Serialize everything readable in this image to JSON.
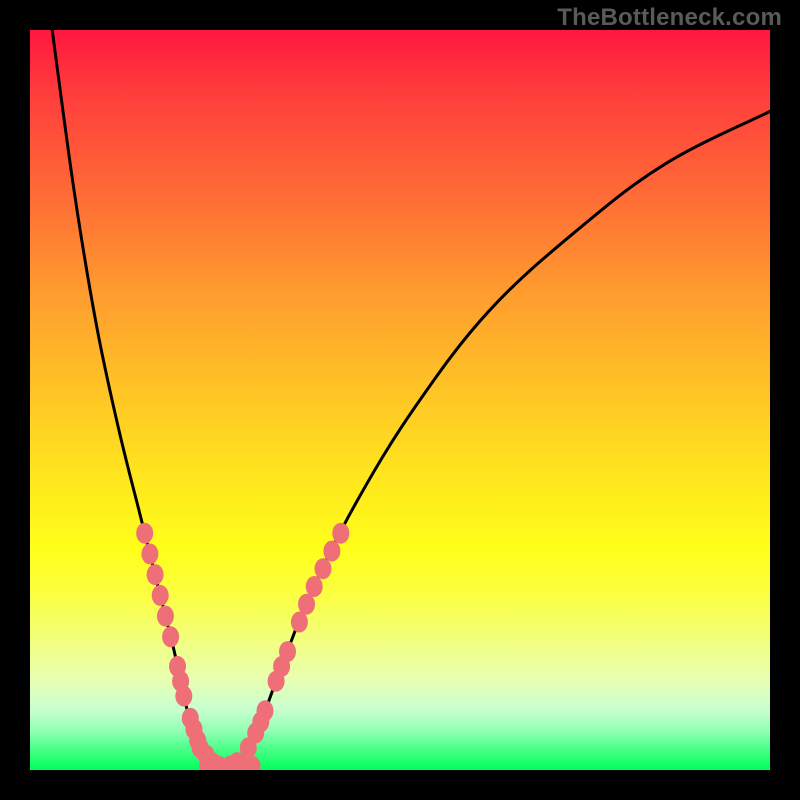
{
  "watermark": "TheBottleneck.com",
  "colors": {
    "background": "#000000",
    "gradient_top": "#ff163f",
    "gradient_bottom": "#00ff5c",
    "curve": "#000000",
    "bead": "#ef6f78"
  },
  "chart_data": {
    "type": "line",
    "title": "",
    "xlabel": "",
    "ylabel": "",
    "xlim": [
      0,
      100
    ],
    "ylim": [
      0,
      100
    ],
    "grid": false,
    "legend": false,
    "series": [
      {
        "name": "left-curve",
        "x": [
          3,
          6,
          9,
          12,
          15,
          18,
          19.5,
          21,
          23,
          25,
          27
        ],
        "y": [
          100,
          78,
          60,
          46,
          34,
          22,
          16,
          9,
          3,
          0.5,
          0
        ]
      },
      {
        "name": "right-curve",
        "x": [
          27,
          29,
          31,
          34,
          38,
          44,
          52,
          62,
          74,
          86,
          100
        ],
        "y": [
          0,
          2,
          6,
          14,
          24,
          36,
          49,
          62,
          73,
          82,
          89
        ]
      }
    ],
    "bead_clusters": [
      {
        "branch": "left",
        "y_start": 32,
        "y_end": 18,
        "count": 6
      },
      {
        "branch": "left",
        "y_start": 14,
        "y_end": 10,
        "count": 3
      },
      {
        "branch": "left",
        "y_start": 7,
        "y_end": 4,
        "count": 3
      },
      {
        "branch": "left",
        "y_start": 3,
        "y_end": 1,
        "count": 3
      },
      {
        "branch": "valley",
        "y_start": 0.5,
        "y_end": 0.5,
        "count": 5
      },
      {
        "branch": "right",
        "y_start": 1,
        "y_end": 3,
        "count": 2
      },
      {
        "branch": "right",
        "y_start": 5,
        "y_end": 8,
        "count": 3
      },
      {
        "branch": "right",
        "y_start": 12,
        "y_end": 16,
        "count": 3
      },
      {
        "branch": "right",
        "y_start": 20,
        "y_end": 32,
        "count": 6
      }
    ],
    "comment": "Axes have no visible tick labels; x/y values are estimated on a 0–100 normalized scale for both axes. y=0 is the green floor (bottom), y=100 is the top edge of the gradient. Curves form a V with minimum at roughly x≈27. Beads cluster on both branches in the lower ~32% of the plot."
  }
}
